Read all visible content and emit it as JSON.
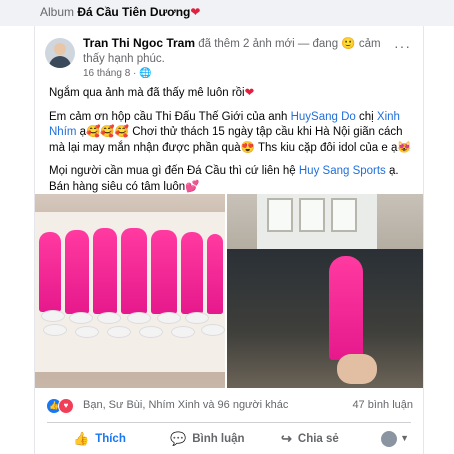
{
  "album": {
    "label": "Album",
    "name": "Đá Cầu Tiên Dương",
    "emoji": "❤"
  },
  "post": {
    "author": "Tran Thi Ngoc Tram",
    "activity": " đã thêm 2 ảnh mới — đang ",
    "feeling_emoji": "🙂",
    "feeling": " cảm thấy hạnh phúc.",
    "date": "16 tháng 8",
    "privacy_icon": "globe-icon",
    "more_label": "···",
    "p1": "Ngắm qua ảnh mà đã thấy mê luôn rồi",
    "p1_emoji": "❤",
    "p2_a": "Em cảm ơn hộp cầu Thi Đấu Thế Giới của anh ",
    "p2_link1": "HuySang Do",
    "p2_b": " chị ",
    "p2_link2": "Xinh Nhím",
    "p2_c": " ạ🥰🥰🥰  Chơi thử thách 15 ngày tập cầu khi Hà Nội giãn cách mà lại may mắn nhận được phần quà😍 Ths kiu cặp đôi idol của e ạ😻",
    "p3_a": "Mọi người cần mua gì đến Đá Cầu thì cứ liên hệ  ",
    "p3_link": "Huy Sang Sports",
    "p3_b": " ạ. Bán hàng siêu có tâm luôn💕"
  },
  "reactions": {
    "names": "Bạn, Sư Bùi, Nhím Xinh và 96 người khác",
    "comments": "47 bình luận"
  },
  "actions": {
    "like": "Thích",
    "comment": "Bình luận",
    "share": "Chia sẻ"
  }
}
